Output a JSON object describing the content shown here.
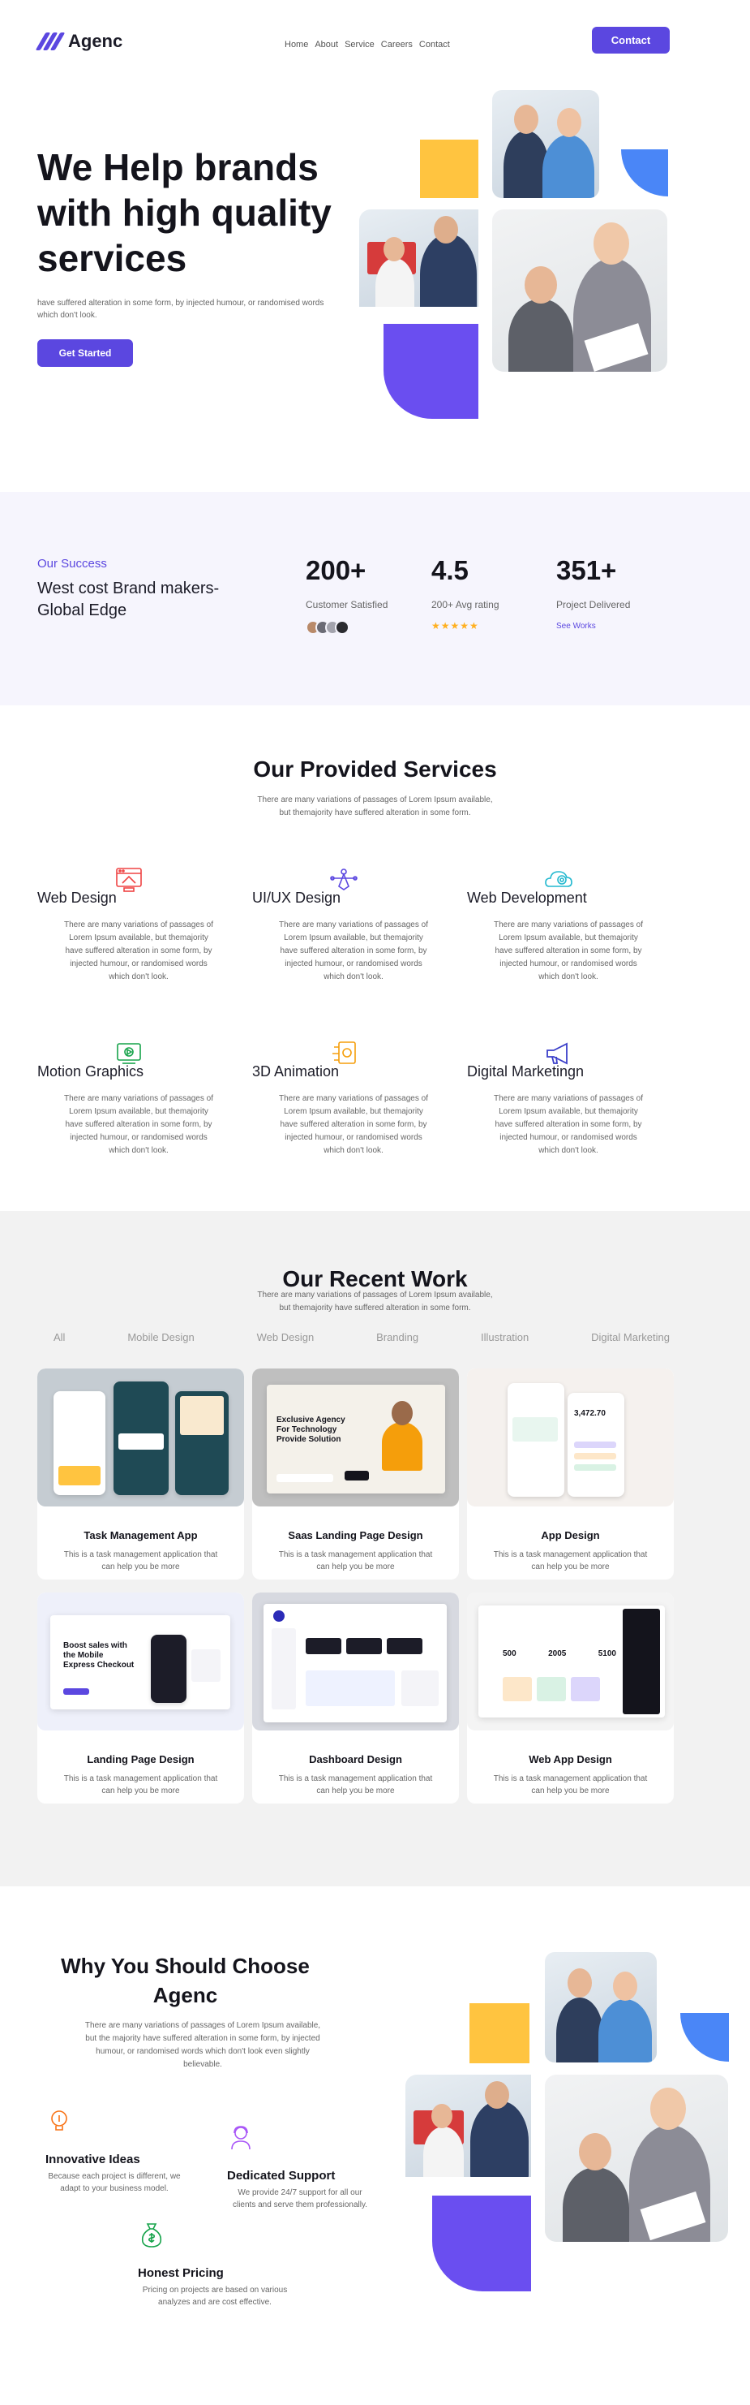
{
  "header": {
    "logo_text": "Agenc",
    "nav": [
      "Home",
      "About",
      "Service",
      "Careers",
      "Contact"
    ],
    "contact_button": "Contact"
  },
  "hero": {
    "title": "We Help brands with high quality services",
    "description": "have suffered alteration in some form, by injected humour, or randomised words which don't look.",
    "cta": "Get Started"
  },
  "stats": {
    "kicker": "Our Success",
    "title": "West cost Brand makers-Global Edge",
    "items": [
      {
        "value": "200+",
        "label": "Customer Satisfied"
      },
      {
        "value": "4.5",
        "label": "200+ Avg rating"
      },
      {
        "value": "351+",
        "label": "Project Delivered",
        "link": "See Works"
      }
    ],
    "stars": "★★★★★"
  },
  "services": {
    "title": "Our Provided Services",
    "subtitle": "There are many variations of passages of Lorem Ipsum available, but themajority have suffered alteration in some form.",
    "items": [
      {
        "name": "Web Design",
        "desc": "There are many variations of passages of Lorem Ipsum available, but themajority have suffered alteration in some form, by injected humour, or randomised words which don't look.",
        "icon": "web-design-icon",
        "color": "#ef4444"
      },
      {
        "name": "UI/UX Design",
        "desc": "There are many variations of passages of Lorem Ipsum available, but themajority have suffered alteration in some form, by injected humour, or randomised words which don't look.",
        "icon": "pen-tool-icon",
        "color": "#5b47e0"
      },
      {
        "name": "Web Development",
        "desc": "There are many variations of passages of Lorem Ipsum available, but themajority have suffered alteration in some form, by injected humour, or randomised words which don't look.",
        "icon": "cloud-gear-icon",
        "color": "#22b8cf"
      },
      {
        "name": "Motion Graphics",
        "desc": "There are many variations of passages of Lorem Ipsum available, but themajority have suffered alteration in some form, by injected humour, or randomised words which don't look.",
        "icon": "motion-icon",
        "color": "#16a34a"
      },
      {
        "name": "3D Animation",
        "desc": "There are many variations of passages of Lorem Ipsum available, but themajority have suffered alteration in some form, by injected humour, or randomised words which don't look.",
        "icon": "animation-icon",
        "color": "#f59e0b"
      },
      {
        "name": "Digital Marketingn",
        "desc": "There are many variations of passages of Lorem Ipsum available, but themajority have suffered alteration in some form, by injected humour, or randomised words which don't look.",
        "icon": "megaphone-icon",
        "color": "#3b3fc9"
      }
    ]
  },
  "work": {
    "title": "Our Recent Work",
    "subtitle": "There are many variations of passages of Lorem Ipsum available, but themajority have suffered alteration in some form.",
    "filters": [
      "All",
      "Mobile Design",
      "Web Design",
      "Branding",
      "Illustration",
      "Digital Marketing"
    ],
    "cards": [
      {
        "title": "Task Management App",
        "desc": "This is a task management application that can help you be more"
      },
      {
        "title": "Saas Landing Page Design",
        "desc": "This is a task management application that can help you be more",
        "mock_headline": "Exclusive Agency For Technology Provide Solution"
      },
      {
        "title": "App Design",
        "desc": "This is a task management application that can help you be more",
        "mock_amount": "3,472.70"
      },
      {
        "title": "Landing Page Design",
        "desc": "This is a task management application that can help you be more",
        "mock_headline": "Boost sales with the Mobile Express Checkout"
      },
      {
        "title": "Dashboard Design",
        "desc": "This is a task management application that can help you be more"
      },
      {
        "title": "Web App Design",
        "desc": "This is a task management application that can help you be more",
        "mock_stats": [
          "500",
          "2005",
          "5100"
        ]
      }
    ]
  },
  "why": {
    "title": "Why You Should Choose Agenc",
    "description": "There are many variations of passages of Lorem Ipsum available, but the majority have suffered alteration in some form, by injected humour, or randomised words which don't look even slightly believable.",
    "features": [
      {
        "name": "Innovative Ideas",
        "desc": "Because each project is different, we adapt to your business model.",
        "icon": "lightbulb-icon",
        "color": "#f97316"
      },
      {
        "name": "Dedicated Support",
        "desc": "We provide 24/7 support for all our clients and serve them professionally.",
        "icon": "support-agent-icon",
        "color": "#a855f7"
      },
      {
        "name": "Honest Pricing",
        "desc": "Pricing on projects are based on various analyzes and are cost effective.",
        "icon": "money-bag-icon",
        "color": "#16a34a"
      }
    ]
  },
  "colors": {
    "brand": "#5b47e0",
    "yellow": "#ffc440",
    "blue": "#4a86f7",
    "purple": "#6a4ef0"
  }
}
